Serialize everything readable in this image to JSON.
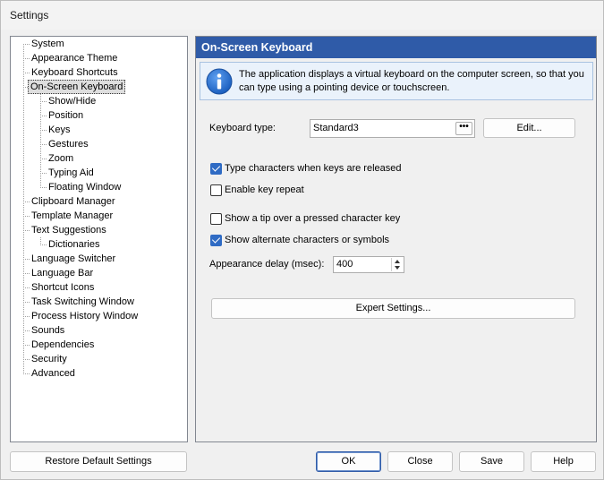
{
  "window": {
    "title": "Settings"
  },
  "tree": {
    "items": [
      {
        "label": "System"
      },
      {
        "label": "Appearance Theme"
      },
      {
        "label": "Keyboard Shortcuts"
      },
      {
        "label": "On-Screen Keyboard",
        "selected": true
      },
      {
        "label": "Show/Hide",
        "child": true
      },
      {
        "label": "Position",
        "child": true
      },
      {
        "label": "Keys",
        "child": true
      },
      {
        "label": "Gestures",
        "child": true
      },
      {
        "label": "Zoom",
        "child": true
      },
      {
        "label": "Typing Aid",
        "child": true
      },
      {
        "label": "Floating Window",
        "child": true
      },
      {
        "label": "Clipboard Manager"
      },
      {
        "label": "Template Manager"
      },
      {
        "label": "Text Suggestions"
      },
      {
        "label": "Dictionaries",
        "child": true
      },
      {
        "label": "Language Switcher"
      },
      {
        "label": "Language Bar"
      },
      {
        "label": "Shortcut Icons"
      },
      {
        "label": "Task Switching Window"
      },
      {
        "label": "Process History Window"
      },
      {
        "label": "Sounds"
      },
      {
        "label": "Dependencies"
      },
      {
        "label": "Security"
      },
      {
        "label": "Advanced"
      }
    ]
  },
  "panel": {
    "title": "On-Screen Keyboard",
    "info_icon": "info-icon",
    "info_text": "The application displays a virtual keyboard on the computer screen, so that you can type using a pointing device or touchscreen.",
    "keyboard_type_label": "Keyboard type:",
    "keyboard_type_value": "Standard3",
    "combo_button_label": "•••",
    "edit_button": "Edit...",
    "checkboxes": [
      {
        "label": "Type characters when keys are released",
        "checked": true
      },
      {
        "label": "Enable key repeat",
        "checked": false
      },
      {
        "label": "Show a tip over a pressed character key",
        "checked": false
      },
      {
        "label": "Show alternate characters or symbols",
        "checked": true
      }
    ],
    "delay_label": "Appearance delay (msec):",
    "delay_value": "400",
    "expert_button": "Expert Settings..."
  },
  "footer": {
    "restore_button": "Restore Default Settings",
    "ok_button": "OK",
    "close_button": "Close",
    "save_button": "Save",
    "help_button": "Help"
  },
  "colors": {
    "header_bg": "#2f5ba8",
    "info_bg": "#eaf2fb",
    "checkbox_checked": "#2f6bc4"
  }
}
